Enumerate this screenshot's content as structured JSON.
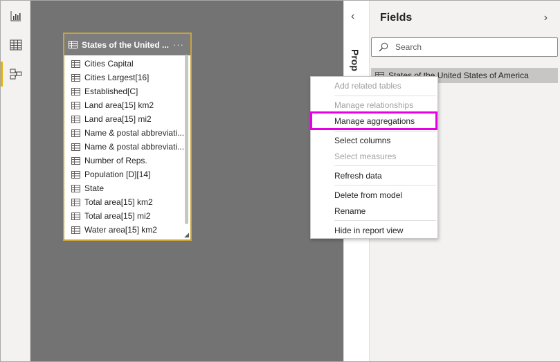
{
  "rail": {
    "items": [
      {
        "name": "report-view",
        "icon": "bar-chart-icon"
      },
      {
        "name": "data-view",
        "icon": "table-grid-icon"
      },
      {
        "name": "model-view",
        "icon": "model-diagram-icon",
        "active": true
      }
    ],
    "accent": "#e8b300"
  },
  "table_card": {
    "title": "States of the United ...",
    "more": "···",
    "columns": [
      "Cities Capital",
      "Cities Largest[16]",
      "Established[C]",
      "Land area[15] km2",
      "Land area[15] mi2",
      "Name & postal abbreviati...",
      "Name & postal abbreviati...",
      "Number of Reps.",
      "Population [D][14]",
      "State",
      "Total area[15] km2",
      "Total area[15] mi2",
      "Water area[15] km2"
    ]
  },
  "properties": {
    "label": "Prop"
  },
  "fields": {
    "title": "Fields",
    "search_placeholder": "Search",
    "table_name": "States of the United States of America"
  },
  "context_menu": {
    "items": [
      {
        "label": "Add related tables",
        "disabled": true
      },
      {
        "label": "Manage relationships",
        "disabled": true
      },
      {
        "label": "Manage aggregations",
        "disabled": false,
        "highlighted": true
      },
      {
        "label": "Select columns",
        "disabled": false
      },
      {
        "label": "Select measures",
        "disabled": true
      },
      {
        "label": "Refresh data",
        "disabled": false
      },
      {
        "label": "Delete from model",
        "disabled": false
      },
      {
        "label": "Rename",
        "disabled": false
      },
      {
        "label": "Hide in report view",
        "disabled": false
      }
    ],
    "highlight_color": "#e600e6"
  }
}
